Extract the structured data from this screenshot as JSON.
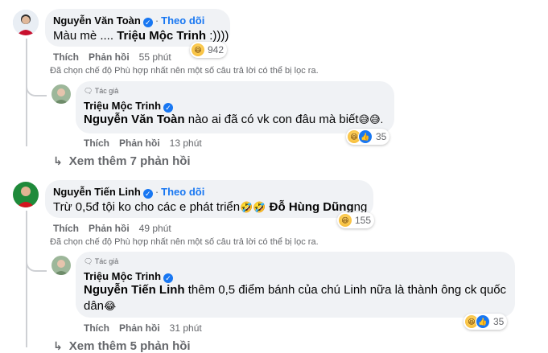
{
  "comments": [
    {
      "author": "Nguyễn Văn Toàn",
      "follow": "Theo dõi",
      "text": "Màu mè .... ",
      "tag": "Triệu Mộc Trinh",
      "text_after": " :))))",
      "reactions": "942",
      "like": "Thích",
      "reply": "Phản hồi",
      "time": "55 phút",
      "note": "Đã chọn chế độ Phù hợp nhất nên một số câu trả lời có thể bị lọc ra.",
      "sub_reply": {
        "badge": "Tác giả",
        "author": "Triệu Mộc Trinh",
        "tag": "Nguyễn Văn Toàn",
        "text": " nào ai đã có vk con đâu mà biết",
        "emoji": "😅😅.",
        "reactions": "35",
        "like": "Thích",
        "reply": "Phản hồi",
        "time": "13 phút"
      },
      "more_replies": "Xem thêm 7 phản hồi"
    },
    {
      "author": "Nguyễn Tiến Linh",
      "follow": "Theo dõi",
      "text": "Trừ 0,5đ tội ko cho các e phát triển",
      "emoji": "🤣🤣",
      "tag": "Đỗ Hùng Dũng",
      "text_after": "ng",
      "reactions": "155",
      "like": "Thích",
      "reply": "Phản hồi",
      "time": "49 phút",
      "note": "Đã chọn chế độ Phù hợp nhất nên một số câu trả lời có thể bị lọc ra.",
      "sub_reply": {
        "badge": "Tác giả",
        "author": "Triệu Mộc Trinh",
        "tag": "Nguyễn Tiến Linh",
        "text": " thêm 0,5 điểm bánh của chú Linh nữa là thành ông ck quốc",
        "text_line2": "dân",
        "emoji": "😂",
        "reactions": "35",
        "like": "Thích",
        "reply": "Phản hồi",
        "time": "31 phút"
      },
      "more_replies": "Xem thêm 5 phản hồi"
    }
  ],
  "colors": {
    "link": "#1877f2",
    "bubble": "#f0f2f5",
    "muted": "#65676b"
  }
}
